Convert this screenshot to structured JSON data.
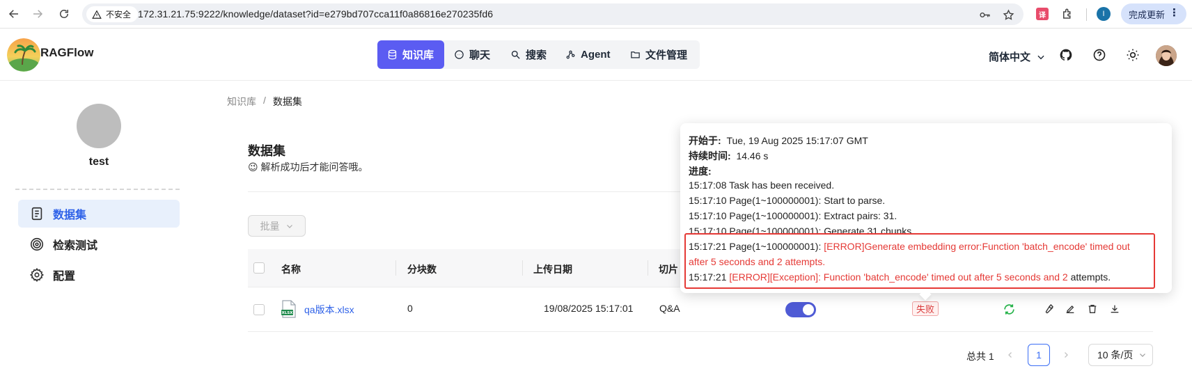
{
  "browser": {
    "security_label": "不安全",
    "url": "172.31.21.75:9222/knowledge/dataset?id=e279bd707cca11f0a86816e270235fd6",
    "profile_initial": "I",
    "update_label": "完成更新",
    "update_menu": "⋮",
    "translate_ext_label": "译"
  },
  "header": {
    "brand": "RAGFlow",
    "nav": [
      {
        "label": "知识库",
        "active": true
      },
      {
        "label": "聊天"
      },
      {
        "label": "搜索"
      },
      {
        "label": "Agent"
      },
      {
        "label": "文件管理"
      }
    ],
    "language": "简体中文"
  },
  "sidebar": {
    "kb_name": "test",
    "items": [
      {
        "label": "数据集",
        "active": true
      },
      {
        "label": "检索测试"
      },
      {
        "label": "配置"
      }
    ]
  },
  "breadcrumb": {
    "root": "知识库",
    "sep": "/",
    "current": "数据集"
  },
  "page": {
    "title": "数据集",
    "description": "😉 解析成功后才能问答哦。",
    "batch_label": "批量"
  },
  "table": {
    "columns": [
      "名称",
      "分块数",
      "上传日期",
      "切片"
    ],
    "rows": [
      {
        "name": "qa版本.xlsx",
        "chunks": "0",
        "upload_date": "19/08/2025 15:17:01",
        "parser": "Q&A",
        "enabled": true,
        "status": "失败",
        "file_type": "XLSX"
      }
    ]
  },
  "pagination": {
    "total": "总共 1",
    "current_page": "1",
    "page_size": "10 条/页"
  },
  "popover": {
    "start_label": "开始于:",
    "start_value": "Tue, 19 Aug 2025 15:17:07 GMT",
    "duration_label": "持续时间:",
    "duration_value": "14.46 s",
    "progress_label": "进度:",
    "log": {
      "l1": "15:17:08 Task has been received.",
      "l2": "15:17:10 Page(1~100000001): Start to parse.",
      "l3": "15:17:10 Page(1~100000001): Extract pairs: 31.",
      "l4": "15:17:10 Page(1~100000001): Generate 31 chunks",
      "l5_prefix": "15:17:21 Page(1~100000001): ",
      "l5_error": "[ERROR]Generate embedding error:Function 'batch_encode' timed out",
      "l6_error": "after 5 seconds and 2 attempts.",
      "l7_prefix": "15:17:21 ",
      "l7_error": "[ERROR][Exception]: Function 'batch_encode' timed out after 5 seconds and 2",
      "l7_suffix": " attempts."
    }
  },
  "colors": {
    "accent": "#5b5cf2",
    "link": "#2f62e8",
    "error": "#e53935",
    "success": "#26b34a"
  }
}
